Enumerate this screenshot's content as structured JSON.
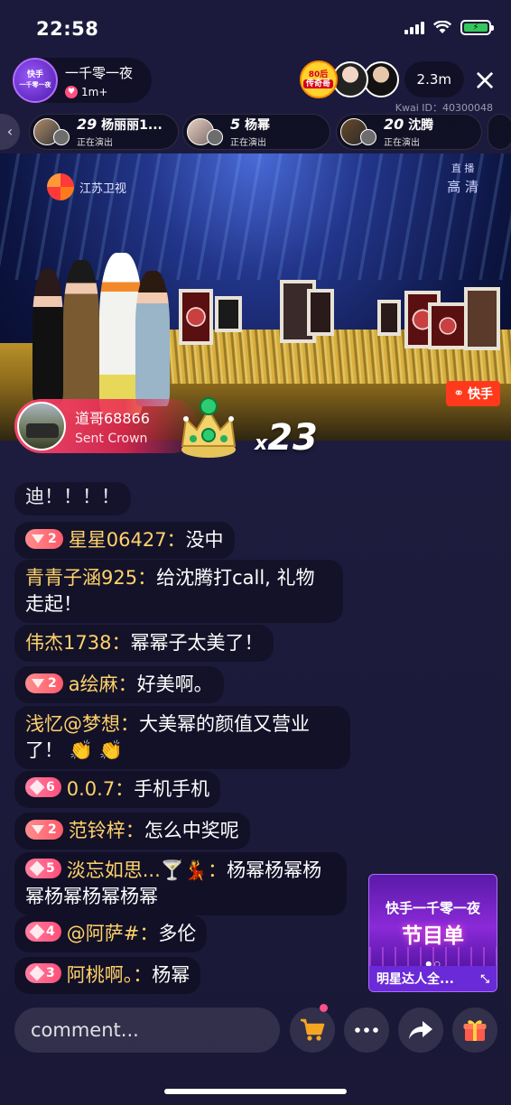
{
  "status_bar": {
    "time": "22:58"
  },
  "host": {
    "name": "一千零一夜",
    "likes": "1m+",
    "avatar_line1": "快手",
    "avatar_line2": "一千零一夜"
  },
  "top_right": {
    "badge_line1": "80后",
    "badge_line2": "传奇哥",
    "viewer_count": "2.3m",
    "close_icon": "×",
    "kwai_id": "Kwai ID：40300048"
  },
  "live_strip": {
    "arrow": "‹",
    "cards": [
      {
        "rank": "29",
        "name": "杨丽丽1...",
        "status": "正在演出"
      },
      {
        "rank": "5",
        "name": "杨幂",
        "status": "正在演出"
      },
      {
        "rank": "20",
        "name": "沈腾",
        "status": "正在演出"
      }
    ]
  },
  "video": {
    "channel": "江苏卫视",
    "live_label": "直 播",
    "hd_label": "高 清",
    "watermark": "快手"
  },
  "gift": {
    "user": "道哥68866",
    "action": "Sent Crown",
    "multiplier": "x",
    "count": "23"
  },
  "chat": [
    {
      "level": "",
      "badge": "none",
      "name": "",
      "text": "迪！！！！"
    },
    {
      "level": "2",
      "badge": "triangle",
      "name": "星星06427：",
      "text": "没中"
    },
    {
      "level": "",
      "badge": "none",
      "name": "青青子涵925：",
      "text": "给沈腾打call, 礼物走起！"
    },
    {
      "level": "",
      "badge": "none",
      "name": "伟杰1738：",
      "text": "幂幂子太美了！"
    },
    {
      "level": "2",
      "badge": "triangle",
      "name": "a绘麻：",
      "text": "好美啊。"
    },
    {
      "level": "",
      "badge": "none",
      "name": "浅忆@梦想：",
      "text": "大美幂的颜值又营业了！ 👏 👏"
    },
    {
      "level": "6",
      "badge": "diamond",
      "name": "0.0.7：",
      "text": "手机手机"
    },
    {
      "level": "2",
      "badge": "triangle",
      "name": "范铃梓：",
      "text": "怎么中奖呢"
    },
    {
      "level": "5",
      "badge": "diamond",
      "name": "淡忘如思...🍸💃：",
      "text": "杨幂杨幂杨幂杨幂杨幂杨幂"
    },
    {
      "level": "4",
      "badge": "diamond",
      "name": "@阿萨#：",
      "text": "多伦"
    },
    {
      "level": "3",
      "badge": "diamond",
      "name": "阿桃啊。：",
      "text": "杨幂"
    }
  ],
  "promo": {
    "top": "快手一千零一夜",
    "title": "节目单",
    "dots": "● ○",
    "bar_text": "明星达人全...",
    "expand_icon": "⤡"
  },
  "bottom": {
    "comment_placeholder": "comment..."
  },
  "colors": {
    "name": "#ffd26b",
    "gift_banner": "#ff4a6e",
    "level_badge": "#ff5a6a"
  }
}
